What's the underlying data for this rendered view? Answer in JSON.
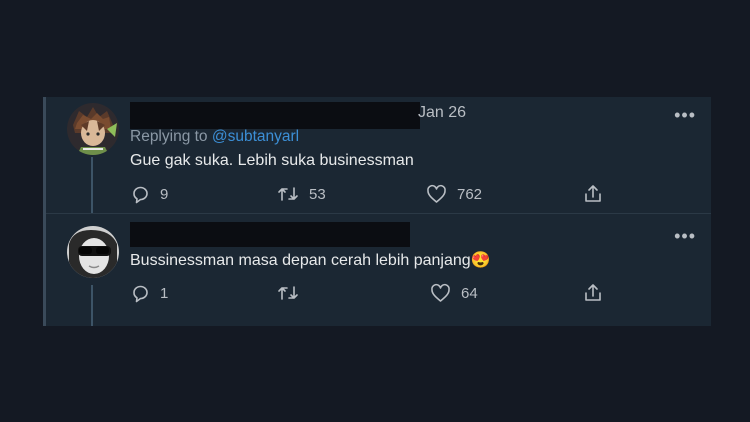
{
  "replies": [
    {
      "date": "Jan 26",
      "replying_prefix": "Replying to ",
      "replying_handle": "@subtanyarl",
      "text": "Gue gak suka. Lebih suka businessman",
      "counts": {
        "reply": "9",
        "retweet": "53",
        "like": "762",
        "share": ""
      }
    },
    {
      "date": "",
      "text": "Bussinessman masa depan cerah lebih panjang",
      "emoji": "😍",
      "counts": {
        "reply": "1",
        "retweet": "",
        "like": "64",
        "share": ""
      }
    }
  ],
  "more_glyph": "•••",
  "colors": {
    "background": "#141923",
    "card": "#1b2733",
    "link": "#3c8fd6",
    "muted": "#8b98a5"
  },
  "icons": [
    "reply-icon",
    "retweet-icon",
    "like-icon",
    "share-icon",
    "more-icon"
  ]
}
